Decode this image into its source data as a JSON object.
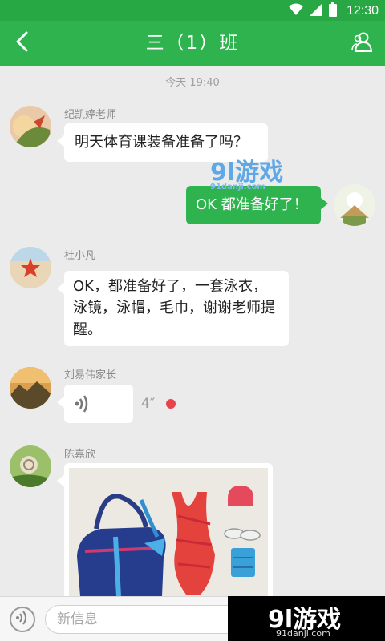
{
  "status_bar": {
    "time": "12:30",
    "wifi_icon": "wifi-icon",
    "signal_icon": "signal-icon",
    "battery_icon": "battery-icon"
  },
  "header": {
    "title": "三（1）班",
    "back_icon": "chevron-left-icon",
    "members_icon": "group-members-icon"
  },
  "chat": {
    "timestamp": "今天 19:40",
    "messages": [
      {
        "sender": "纪凯婷老师",
        "side": "left",
        "type": "text",
        "text": "明天体育课装备准备了吗？"
      },
      {
        "sender": "",
        "side": "right",
        "type": "text",
        "text": "OK 都准备好了！"
      },
      {
        "sender": "杜小凡",
        "side": "left",
        "type": "text",
        "text": "OK，都准备好了，一套泳衣，泳镜，泳帽，毛巾，谢谢老师提醒。"
      },
      {
        "sender": "刘易伟家长",
        "side": "left",
        "type": "voice",
        "duration": "4″",
        "unread": true
      },
      {
        "sender": "陈嘉欣",
        "side": "left",
        "type": "image",
        "alt": "swim gear photo"
      }
    ]
  },
  "composer": {
    "placeholder": "新信息",
    "voice_icon": "voice-icon"
  },
  "watermark": {
    "text": "9l游戏",
    "sub": "91danji.com"
  },
  "corner_logo": {
    "text": "9l游戏",
    "sub": "91danji.com"
  },
  "colors": {
    "brand_green": "#2fb34f",
    "status_green": "#28a745",
    "bg": "#ebebeb",
    "unread_red": "#e8434b"
  }
}
